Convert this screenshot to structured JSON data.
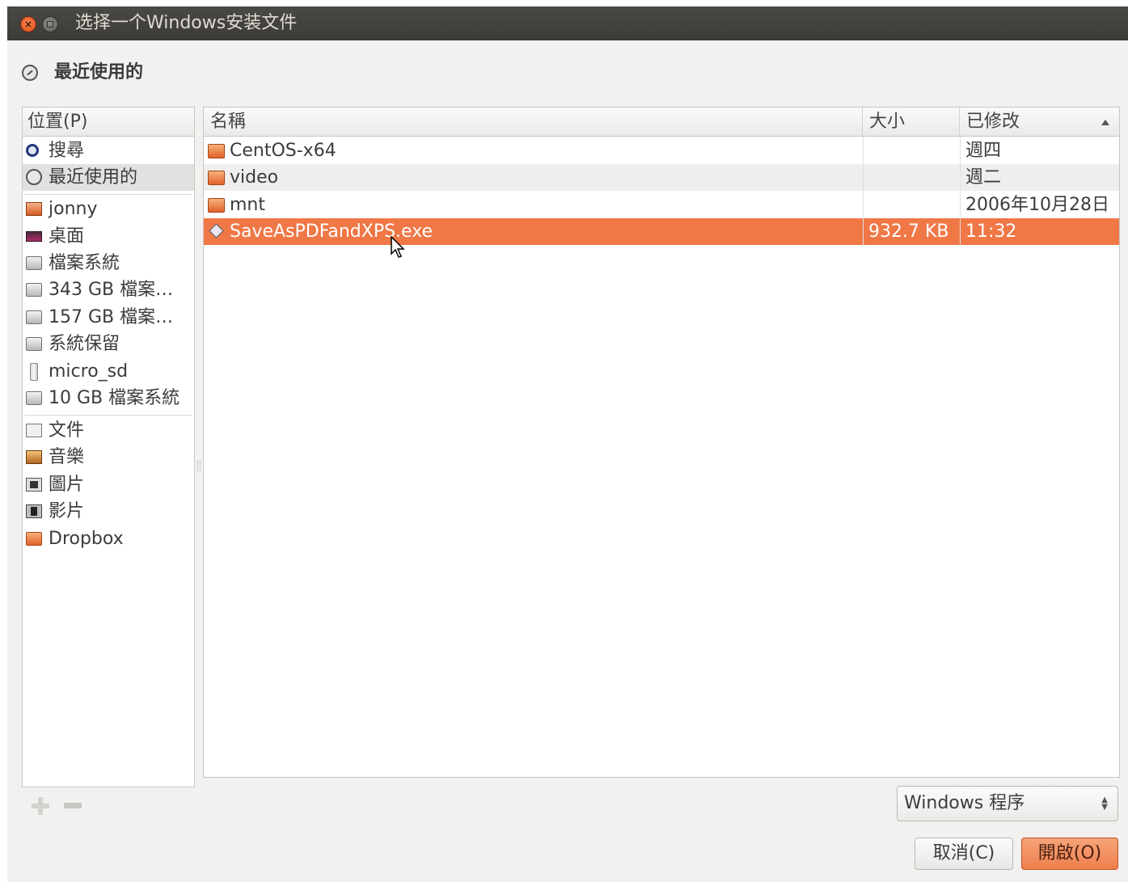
{
  "window": {
    "title": "选择一个Windows安装文件"
  },
  "path_bar": {
    "label": "最近使用的",
    "icon": "recent-clock-icon"
  },
  "places": {
    "header": "位置(P)",
    "items": [
      {
        "label": "搜尋",
        "icon": "search-icon"
      },
      {
        "label": "最近使用的",
        "icon": "recent-icon",
        "selected": true
      },
      {
        "label": "jonny",
        "icon": "home-folder-icon"
      },
      {
        "label": "桌面",
        "icon": "desktop-icon"
      },
      {
        "label": "檔案系統",
        "icon": "drive-icon"
      },
      {
        "label": "343 GB 檔案…",
        "icon": "drive-icon"
      },
      {
        "label": "157 GB 檔案…",
        "icon": "drive-icon"
      },
      {
        "label": "系統保留",
        "icon": "drive-icon"
      },
      {
        "label": "micro_sd",
        "icon": "usb-drive-icon"
      },
      {
        "label": "10 GB 檔案系統",
        "icon": "drive-icon"
      },
      {
        "label": "文件",
        "icon": "documents-folder-icon"
      },
      {
        "label": "音樂",
        "icon": "music-folder-icon"
      },
      {
        "label": "圖片",
        "icon": "pictures-folder-icon"
      },
      {
        "label": "影片",
        "icon": "videos-folder-icon"
      },
      {
        "label": "Dropbox",
        "icon": "folder-icon"
      }
    ]
  },
  "files": {
    "columns": {
      "name": "名稱",
      "size": "大小",
      "modified": "已修改"
    },
    "rows": [
      {
        "name": "CentOS-x64",
        "size": "",
        "modified": "週四",
        "icon": "folder-icon"
      },
      {
        "name": "video",
        "size": "",
        "modified": "週二",
        "icon": "folder-icon"
      },
      {
        "name": "mnt",
        "size": "",
        "modified": "2006年10月28日",
        "icon": "folder-icon"
      },
      {
        "name": "SaveAsPDFandXPS.exe",
        "size": "932.7 KB",
        "modified": "11:32",
        "icon": "executable-icon",
        "selected": true
      }
    ]
  },
  "filter": {
    "selected": "Windows 程序"
  },
  "buttons": {
    "cancel": "取消(C)",
    "open": "開啟(O)"
  },
  "colors": {
    "selection": "#f07746",
    "titlebar": "#3c3b37"
  }
}
